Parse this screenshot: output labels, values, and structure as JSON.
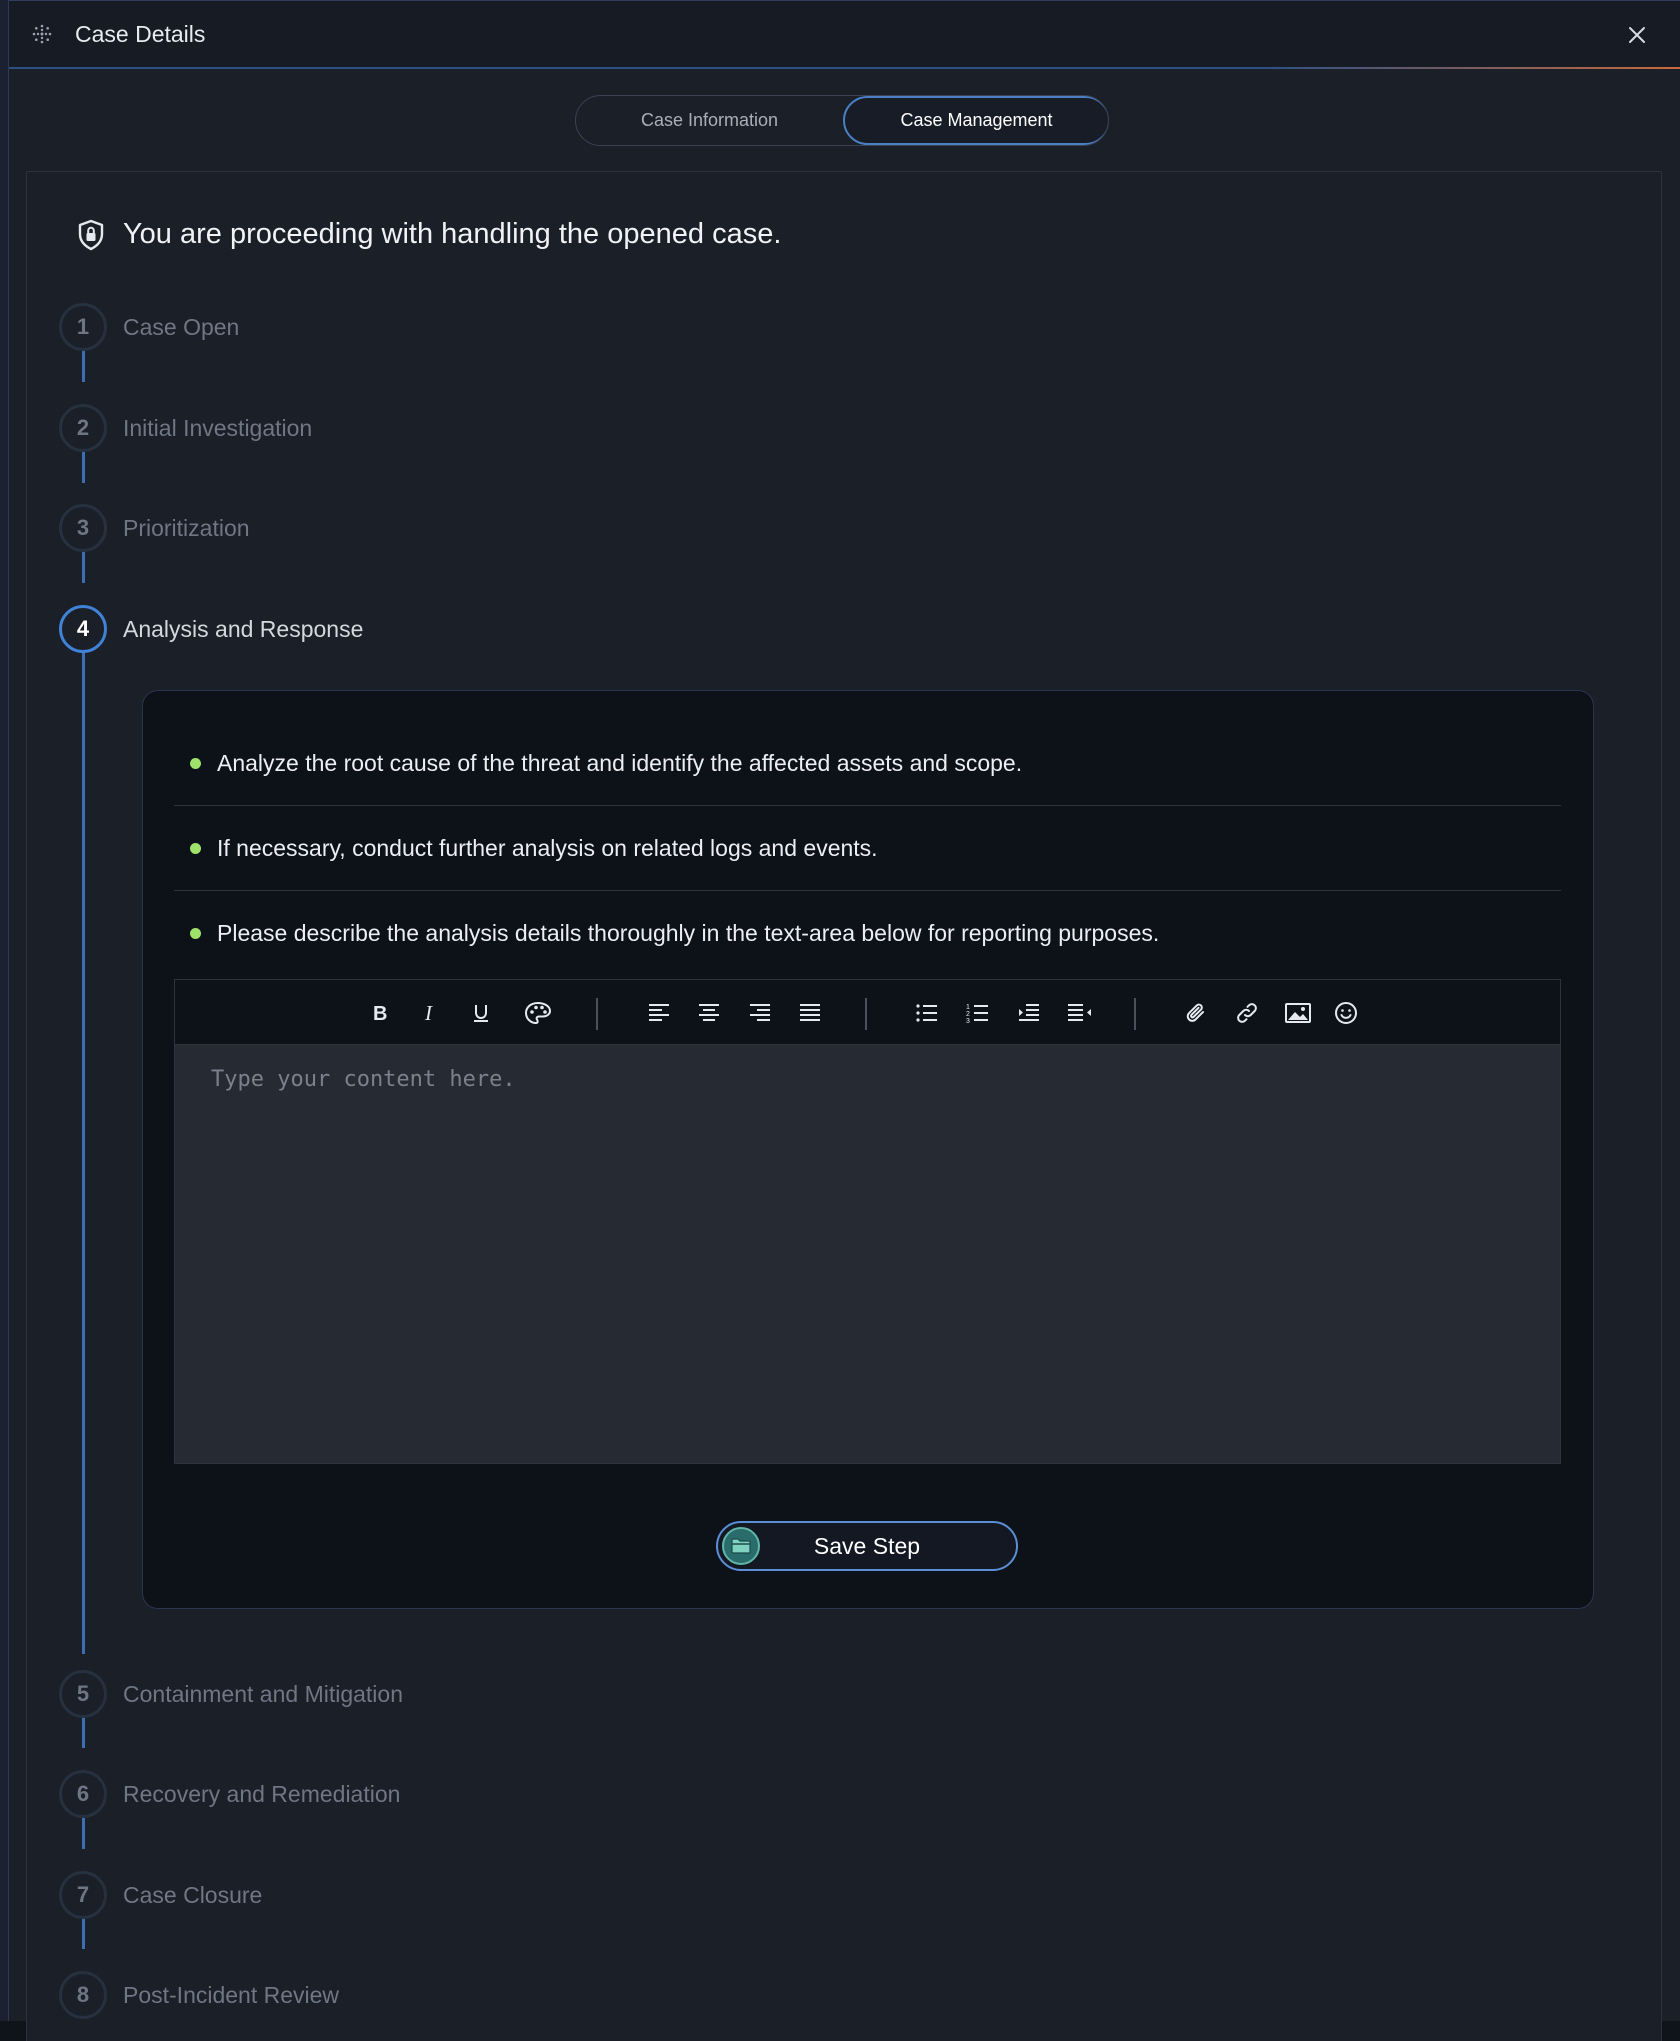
{
  "window": {
    "title": "Case Details",
    "app_icon": "cog-dots-icon",
    "close_icon": "close-icon"
  },
  "tabs": [
    {
      "label": "Case Information",
      "active": false
    },
    {
      "label": "Case Management",
      "active": true
    }
  ],
  "heading": {
    "icon": "shield-lock-icon",
    "text": "You are proceeding with handling the opened case."
  },
  "steps": [
    {
      "num": "1",
      "label": "Case Open"
    },
    {
      "num": "2",
      "label": "Initial Investigation"
    },
    {
      "num": "3",
      "label": "Prioritization"
    },
    {
      "num": "4",
      "label": "Analysis and Response"
    },
    {
      "num": "5",
      "label": "Containment and Mitigation"
    },
    {
      "num": "6",
      "label": "Recovery and Remediation"
    },
    {
      "num": "7",
      "label": "Case Closure"
    },
    {
      "num": "8",
      "label": "Post-Incident Review"
    }
  ],
  "active_step": "4",
  "instructions": [
    "Analyze the root cause of the threat and identify the affected assets and scope.",
    "If necessary, conduct further analysis on related logs and events.",
    "Please describe the analysis details thoroughly in the text-area below for reporting purposes."
  ],
  "editor": {
    "placeholder": "Type your content here.",
    "toolbar": [
      "bold-icon",
      "italic-icon",
      "underline-icon",
      "palette-icon",
      "align-left-icon",
      "align-center-icon",
      "align-right-icon",
      "align-justify-icon",
      "bullet-list-icon",
      "numbered-list-icon",
      "indent-icon",
      "outdent-icon",
      "attachment-icon",
      "link-icon",
      "image-icon",
      "emoji-icon"
    ]
  },
  "save_button": {
    "label": "Save Step",
    "icon": "folder-icon"
  },
  "colors": {
    "accent": "#3f82d6",
    "bullet": "#9fe26b",
    "background": "#1b1f28"
  }
}
